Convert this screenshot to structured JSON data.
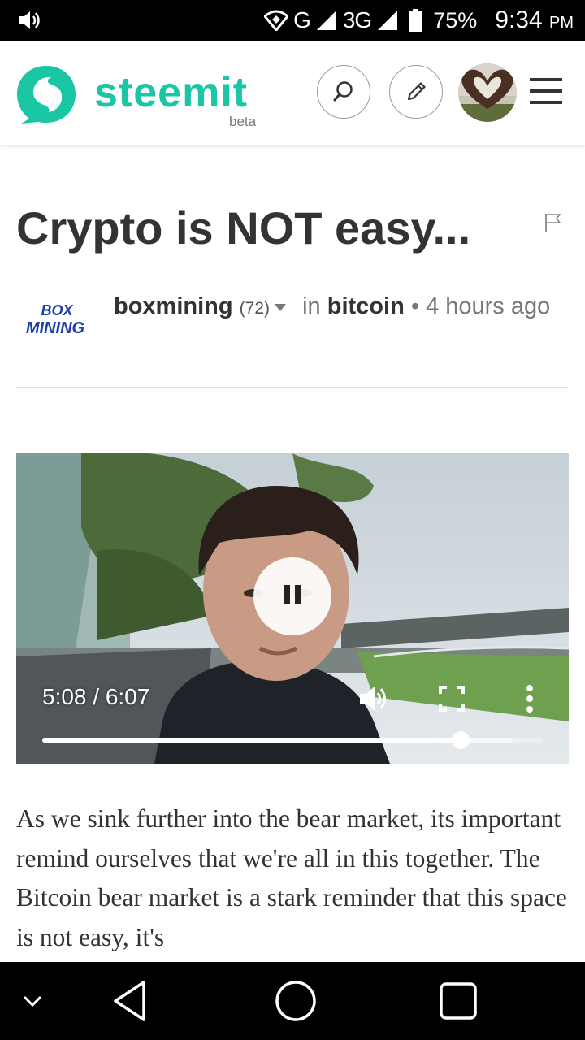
{
  "status_bar": {
    "network_g": "G",
    "network_3g": "3G",
    "battery": "75%",
    "time": "9:34",
    "ampm": "PM"
  },
  "header": {
    "logo_text": "steemit",
    "logo_sub": "beta",
    "accent_color": "#1ac6a3",
    "icons": [
      "search-icon",
      "pencil-icon",
      "user-avatar",
      "hamburger-menu-icon"
    ]
  },
  "post": {
    "title": "Crypto is NOT easy...",
    "author_logo_line1": "BOX",
    "author_logo_line2": "MINING",
    "author": "boxmining",
    "reputation": "(72)",
    "in_label": "in",
    "category": "bitcoin",
    "time_ago": "4 hours ago"
  },
  "video": {
    "time_display": "5:08 / 6:07",
    "progress": 0.8365,
    "buffered": 0.94,
    "state": "playing"
  },
  "body_text": "As we sink further into the bear market, its important remind ourselves that we're all in this together. The Bitcoin bear market is a stark reminder that this space is not easy, it's"
}
